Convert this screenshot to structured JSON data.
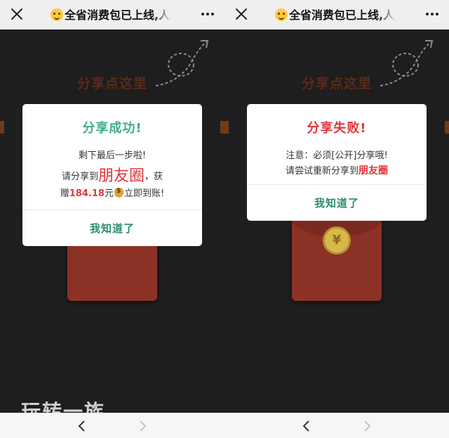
{
  "screens": [
    {
      "id": "left",
      "header": {
        "title": "全省消费包已上线,人人"
      },
      "background": {
        "share_hint": "分享点这里",
        "bottom_text": "玩转一族"
      },
      "dialog": {
        "title": "分享成功!",
        "title_color": "#3fae85",
        "line1": "剩下最后一步啦!",
        "line2_prefix": "请分享到",
        "line2_highlight": "朋友圈",
        "line2_suffix": "，获",
        "line3_prefix": "赠",
        "line3_amount": "184.18",
        "line3_unit": "元",
        "line3_icon": "money-bag-icon",
        "line3_suffix": "立即到账!",
        "button": "我知道了"
      },
      "nav": {
        "back": "back-icon",
        "forward": "forward-icon"
      }
    },
    {
      "id": "right",
      "header": {
        "title": "全省消费包已上线,人人"
      },
      "background": {
        "share_hint": "分享点这里",
        "coin_symbol": "¥"
      },
      "dialog": {
        "title": "分享失败!",
        "title_color": "#e2353a",
        "line1": "注意：必须[公开]分享哦!",
        "line2_prefix": "请尝试重新分享到",
        "line2_highlight": "朋友圈",
        "button": "我知道了"
      },
      "nav": {
        "back": "back-icon",
        "forward": "forward-icon"
      }
    }
  ],
  "colors": {
    "accent_green": "#2e8b6e",
    "accent_red": "#e2353a",
    "page_dark": "#1e1e1e",
    "envelope_red": "#8c3126"
  }
}
